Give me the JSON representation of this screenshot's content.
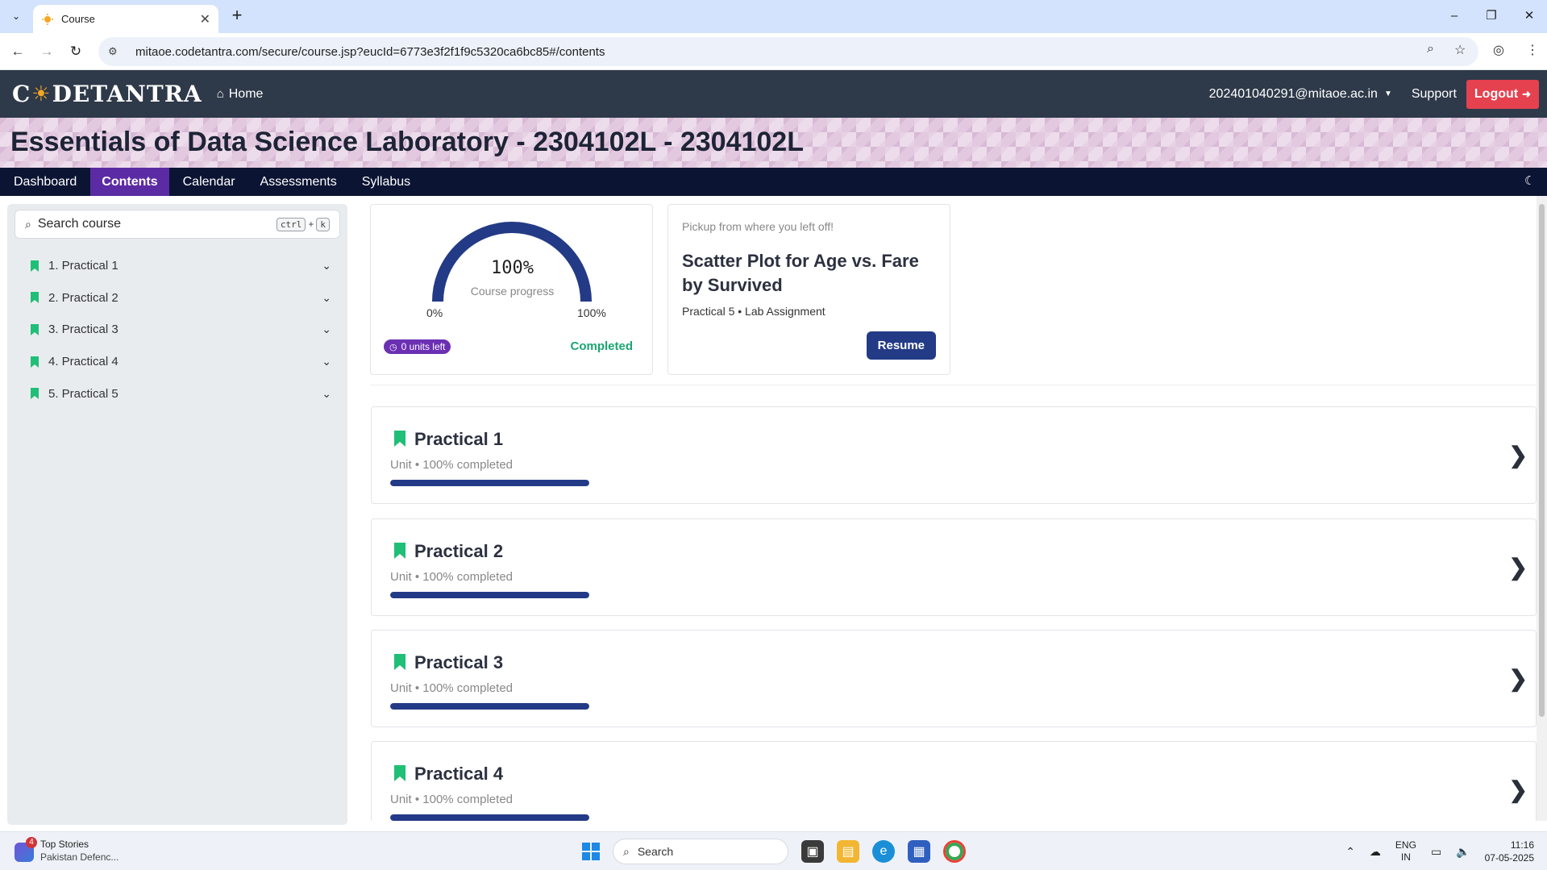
{
  "browser": {
    "tab_title": "Course",
    "url": "mitaoe.codetantra.com/secure/course.jsp?eucId=6773e3f2f1f9c5320ca6bc85#/contents"
  },
  "header": {
    "logo_left": "C",
    "logo_right": "DETANTRA",
    "home": "Home",
    "user": "202401040291@mitaoe.ac.in",
    "support": "Support",
    "logout": "Logout"
  },
  "course": {
    "title": "Essentials of Data Science Laboratory - 2304102L - 2304102L"
  },
  "course_nav": {
    "items": [
      "Dashboard",
      "Contents",
      "Calendar",
      "Assessments",
      "Syllabus"
    ],
    "active": "Contents"
  },
  "sidebar": {
    "search_placeholder": "Search course",
    "kbd_ctrl": "ctrl",
    "kbd_plus": "+",
    "kbd_k": "k",
    "units": [
      {
        "label": "1. Practical 1"
      },
      {
        "label": "2. Practical 2"
      },
      {
        "label": "3. Practical 3"
      },
      {
        "label": "4. Practical 4"
      },
      {
        "label": "5. Practical 5"
      }
    ]
  },
  "progress": {
    "percent_label": "100%",
    "percent_value": 100,
    "caption": "Course progress",
    "min_label": "0%",
    "max_label": "100%",
    "units_left": "0 units left",
    "status": "Completed"
  },
  "resume": {
    "pickup": "Pickup from where you left off!",
    "title": "Scatter Plot for Age vs. Fare by Survived",
    "meta": "Practical 5 • Lab Assignment",
    "button": "Resume"
  },
  "unit_cards": [
    {
      "title": "Practical 1",
      "subtitle": "Unit • 100% completed",
      "progress": 1.0
    },
    {
      "title": "Practical 2",
      "subtitle": "Unit • 100% completed",
      "progress": 1.0
    },
    {
      "title": "Practical 3",
      "subtitle": "Unit • 100% completed",
      "progress": 1.0
    },
    {
      "title": "Practical 4",
      "subtitle": "Unit • 100% completed",
      "progress": 1.0
    }
  ],
  "colors": {
    "header_bg": "#2e3949",
    "nav_bg": "#0b1433",
    "nav_active": "#5b2ba3",
    "accent_navy": "#233a86",
    "bookmark_green": "#1fbf77",
    "logout_red": "#e5414f"
  },
  "taskbar": {
    "news_badge": "4",
    "news_title": "Top Stories",
    "news_sub": "Pakistan Defenc...",
    "search": "Search",
    "lang_top": "ENG",
    "lang_bottom": "IN",
    "time": "11:16",
    "date": "07-05-2025"
  }
}
